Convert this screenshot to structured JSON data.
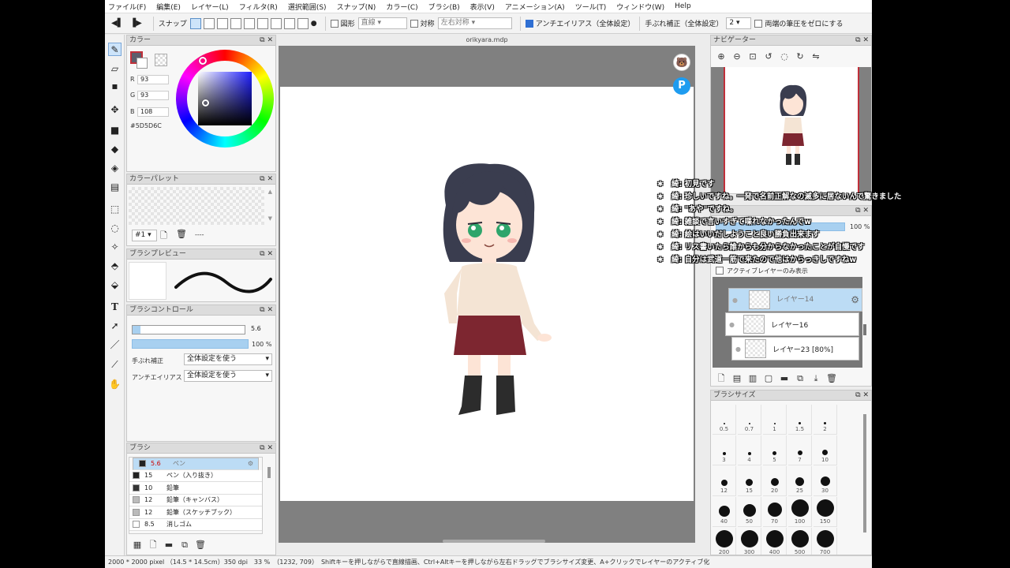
{
  "menu": [
    "ファイル(F)",
    "編集(E)",
    "レイヤー(L)",
    "フィルタ(R)",
    "選択範囲(S)",
    "スナップ(N)",
    "カラー(C)",
    "ブラシ(B)",
    "表示(V)",
    "アニメーション(A)",
    "ツール(T)",
    "ウィンドウ(W)",
    "Help"
  ],
  "toolbar": {
    "snap_label": "スナップ",
    "figure_label": "図形",
    "figure_value": "直線",
    "symmetry_label": "対称",
    "symmetry_value": "左右対称",
    "antialias_label": "アンチエイリアス（全体設定）",
    "stabilizer_label": "手ぶれ補正（全体設定）",
    "stabilizer_value": "2",
    "pressure_label": "両端の筆圧をゼロにする"
  },
  "color_panel": {
    "title": "カラー",
    "r_label": "R",
    "r_value": "93",
    "g_label": "G",
    "g_value": "93",
    "b_label": "B",
    "b_value": "108",
    "hex": "#5D5D6C",
    "current_color": "#5D5D6C"
  },
  "palette_panel": {
    "title": "カラーパレット",
    "index_value": "#1",
    "name_value": "----"
  },
  "brush_preview": {
    "title": "ブラシプレビュー"
  },
  "brush_control": {
    "title": "ブラシコントロール",
    "size_value": "5.6",
    "opacity_value": "100 %",
    "stabilizer_label": "手ぶれ補正",
    "stabilizer_value": "全体設定を使う",
    "antialias_label": "アンチエイリアス",
    "antialias_value": "全体設定を使う"
  },
  "brush_list": {
    "title": "ブラシ",
    "items": [
      {
        "size": "5.6",
        "name": "ペン",
        "color": "#222222",
        "selected": true
      },
      {
        "size": "15",
        "name": "ペン（入り抜き）",
        "color": "#222222"
      },
      {
        "size": "10",
        "name": "鉛筆",
        "color": "#333333"
      },
      {
        "size": "12",
        "name": "鉛筆（キャンバス）",
        "color": "#bbbbbb"
      },
      {
        "size": "12",
        "name": "鉛筆（スケッチブック）",
        "color": "#bbbbbb"
      },
      {
        "size": "8.5",
        "name": "消しゴム",
        "color": "#ffffff"
      }
    ]
  },
  "canvas": {
    "tab_title": "orikyara.mdp"
  },
  "navigator": {
    "title": "ナビゲーター"
  },
  "layer_panel": {
    "opacity_value": "100 %",
    "active_only_label": "アクティブレイヤーのみ表示",
    "layers": [
      {
        "name": "レイヤー14",
        "selected": true
      },
      {
        "name": "レイヤー16"
      },
      {
        "name": "レイヤー23 [80%]"
      }
    ]
  },
  "brush_size_panel": {
    "title": "ブラシサイズ",
    "sizes": [
      "0.5",
      "0.7",
      "1",
      "1.5",
      "2",
      "3",
      "4",
      "5",
      "7",
      "10",
      "12",
      "15",
      "20",
      "25",
      "30",
      "40",
      "50",
      "70",
      "100",
      "150",
      "200",
      "300",
      "400",
      "500",
      "700"
    ]
  },
  "status": {
    "text": "2000 * 2000 pixel （14.5 * 14.5cm）350 dpi　33 %　（1232, 709）　Shiftキーを押しながらで直線描画、Ctrl+Altキーを押しながら左右ドラッグでブラシサイズ変更、A+クリックでレイヤーのアクティブ化"
  },
  "chat": [
    "綺: 初見です",
    "綺: 珍しいですね。一発で名前正解なの滅多に居ないんで驚きました",
    "綺: \"あや\"ですね。",
    "綺: 雑談で言いすぎて喋れなかったんでw",
    "綺: 絵はいいだしようこと良い勝負出来ます",
    "綺: リス書いたら誰からも分からなかったことが自慢です",
    "綺: 自分は武道一筋で来たので他はからっきしですねw"
  ]
}
